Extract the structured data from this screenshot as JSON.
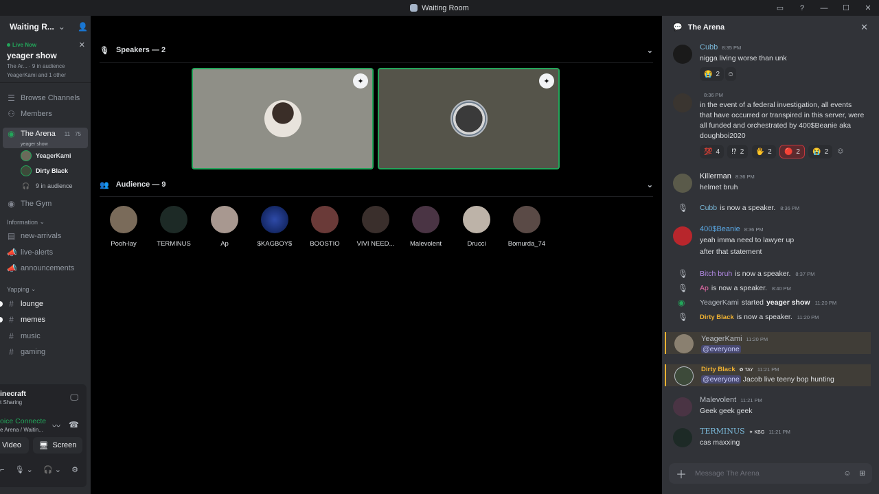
{
  "window": {
    "title": "Waiting Room",
    "controls": [
      "▭",
      "?",
      "—",
      "☐",
      "✕"
    ]
  },
  "sidebar": {
    "server_name": "Waiting R...",
    "live": {
      "status": "Live Now",
      "show": "yeager show",
      "channel": "The Ar...",
      "audience": "9 in audience",
      "speakers": "YeagerKami and 1 other"
    },
    "nav": [
      {
        "icon": "☰",
        "label": "Browse Channels"
      },
      {
        "icon": "👥",
        "label": "Members"
      }
    ],
    "stage_channel": {
      "name": "The Arena",
      "count_a": "11",
      "count_b": "75",
      "subtitle": "yeager show"
    },
    "stage_members": [
      "YeagerKami",
      "Dirty Black"
    ],
    "stage_audience": "9 in audience",
    "gym": "The Gym",
    "cat_information": "Information",
    "info_channels": [
      "new-arrivals",
      "live-alerts",
      "announcements"
    ],
    "cat_yapping": "Yapping",
    "yap_channels": [
      "lounge",
      "memes",
      "music",
      "gaming"
    ],
    "panel": {
      "activity": "inecraft",
      "activity_sub": "t Sharing",
      "voice": "oice Connecte",
      "voice_sub": "e Arena / Waitin...",
      "video_label": "Video",
      "screen_label": "Screen"
    }
  },
  "stage": {
    "speakers_header": "Speakers — 2",
    "audience_header": "Audience — 9",
    "audience": [
      "Pooh-lay",
      "TERMINUS",
      "Ap",
      "$KAGBOY$",
      "BOOSTIO",
      "VIVI NEED...",
      "Malevolent",
      "Drucci",
      "Bomurda_74"
    ]
  },
  "chat": {
    "title": "The Arena",
    "messages": [
      {
        "name": "Cubb",
        "time": "8:35 PM",
        "text": "nigga living worse than unk",
        "reaction": "2"
      },
      {
        "name": "",
        "time": "8:36 PM",
        "text": "in the event of a federal investigation, all events that have occurred or transpired in this server, were all funded and orchestrated by 400$Beanie aka doughboi2020",
        "reactions": [
          "4",
          "2",
          "2",
          "2",
          "2"
        ]
      },
      {
        "name": "Killerman",
        "time": "8:36 PM",
        "text": "helmet bruh"
      },
      {
        "name": "400$Beanie",
        "time": "8:36 PM",
        "text": "yeah imma need to lawyer up",
        "text2": "after that statement"
      },
      {
        "name": "YeagerKami",
        "time": "11:20 PM",
        "mention": "@everyone"
      },
      {
        "name": "Dirty Black",
        "tag": "TAY",
        "time": "11:21 PM",
        "mention": "@everyone",
        "text": "Jacob live teeny bop hunting"
      },
      {
        "name": "Malevolent",
        "time": "11:21 PM",
        "text": "Geek geek geek"
      },
      {
        "name": "TERMINUS",
        "tag": "KBG",
        "time": "11:21 PM",
        "text": "cas maxxing"
      }
    ],
    "system": [
      {
        "name": "Cubb",
        "action": "is now a speaker.",
        "time": "8:36 PM"
      },
      {
        "name": "Bitch bruh",
        "action": "is now a speaker.",
        "time": "8:37 PM"
      },
      {
        "name": "Ap",
        "action": "is now a speaker.",
        "time": "8:40 PM"
      },
      {
        "name": "YeagerKami",
        "action": "started",
        "bold": "yeager show",
        "time": "11:20 PM"
      },
      {
        "name": "Dirty Black",
        "action": "is now a speaker.",
        "time": "11:20 PM"
      }
    ],
    "input_placeholder": "Message The Arena"
  }
}
